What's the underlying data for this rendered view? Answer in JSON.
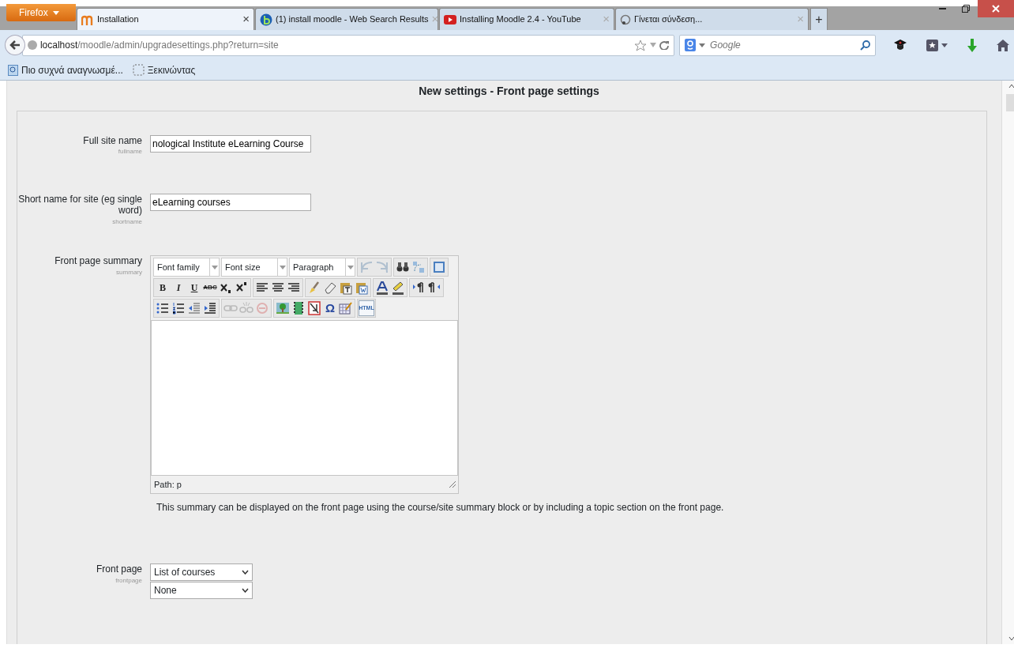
{
  "browser": {
    "menu_button": "Firefox",
    "tabs": [
      {
        "label": "Installation",
        "close": "×",
        "selected": true
      },
      {
        "label": "(1) install moodle - Web Search Results",
        "close": "×",
        "selected": false
      },
      {
        "label": "Installing Moodle 2.4 - YouTube",
        "close": "×",
        "selected": false
      },
      {
        "label": "Γίνεται σύνδεση...",
        "close": "×",
        "selected": false
      }
    ],
    "new_tab": "+",
    "url": {
      "host": "localhost",
      "path": "/moodle/admin/upgradesettings.php?return=site"
    },
    "search": {
      "placeholder": "Google"
    },
    "bookmarks": [
      {
        "label": "Πιο συχνά αναγνωσμέ..."
      },
      {
        "label": "Ξεκινώντας"
      }
    ]
  },
  "page": {
    "title": "New settings - Front page settings",
    "settings": [
      {
        "kind": "text",
        "label": "Full site name",
        "name": "fullname",
        "value": "nological Institute eLearning Course"
      },
      {
        "kind": "text",
        "label": "Short name for site (eg single word)",
        "name": "shortname",
        "value": "eLearning courses"
      },
      {
        "kind": "editor",
        "label": "Front page summary",
        "name": "summary",
        "toolbar": [
          [
            {
              "kind": "select",
              "label": "Font family"
            },
            {
              "kind": "select",
              "label": "Font size"
            },
            {
              "kind": "select",
              "label": "Paragraph"
            },
            {
              "kind": "buttons",
              "buttons": [
                {
                  "disabled": true
                },
                {
                  "disabled": true
                }
              ]
            },
            {
              "kind": "buttons",
              "buttons": [
                {
                  "disabled": false
                },
                {
                  "disabled": false
                }
              ]
            },
            {
              "kind": "buttons",
              "buttons": [
                {
                  "disabled": false
                }
              ]
            }
          ],
          [
            {
              "kind": "buttons",
              "buttons": [
                {
                  "text": "B",
                  "disabled": false
                },
                {
                  "text": "I",
                  "disabled": false
                },
                {
                  "text": "U",
                  "disabled": false
                },
                {
                  "text": "ABC",
                  "disabled": false
                },
                {
                  "disabled": false
                },
                {
                  "disabled": false
                }
              ]
            },
            {
              "kind": "buttons",
              "buttons": [
                {
                  "disabled": false
                },
                {
                  "disabled": false
                },
                {
                  "disabled": false
                }
              ]
            },
            {
              "kind": "buttons",
              "buttons": [
                {
                  "disabled": false
                },
                {
                  "disabled": false
                },
                {
                  "disabled": false
                },
                {
                  "disabled": false
                }
              ]
            },
            {
              "kind": "buttons",
              "buttons": [
                {
                  "disabled": false
                },
                {
                  "disabled": false
                }
              ]
            },
            {
              "kind": "buttons",
              "buttons": [
                {
                  "disabled": false
                },
                {
                  "disabled": false
                }
              ]
            }
          ],
          [
            {
              "kind": "buttons",
              "buttons": [
                {
                  "disabled": false
                },
                {
                  "disabled": false
                },
                {
                  "disabled": false
                },
                {
                  "disabled": false
                }
              ]
            },
            {
              "kind": "buttons",
              "buttons": [
                {
                  "disabled": true
                },
                {
                  "disabled": true
                },
                {
                  "disabled": true
                }
              ]
            },
            {
              "kind": "buttons",
              "buttons": [
                {
                  "disabled": false
                },
                {
                  "disabled": false
                },
                {
                  "disabled": false
                },
                {
                  "text": "Ω",
                  "disabled": false
                },
                {
                  "disabled": false
                }
              ]
            },
            {
              "kind": "buttons",
              "buttons": [
                {
                  "text": "HTML",
                  "disabled": false
                }
              ]
            }
          ]
        ],
        "path": "Path: p",
        "description": "This summary can be displayed on the front page using the course/site summary block or by including a topic section on the front page."
      },
      {
        "kind": "select",
        "label": "Front page",
        "name": "frontpage",
        "values": [
          "List of courses",
          "None"
        ]
      }
    ]
  }
}
